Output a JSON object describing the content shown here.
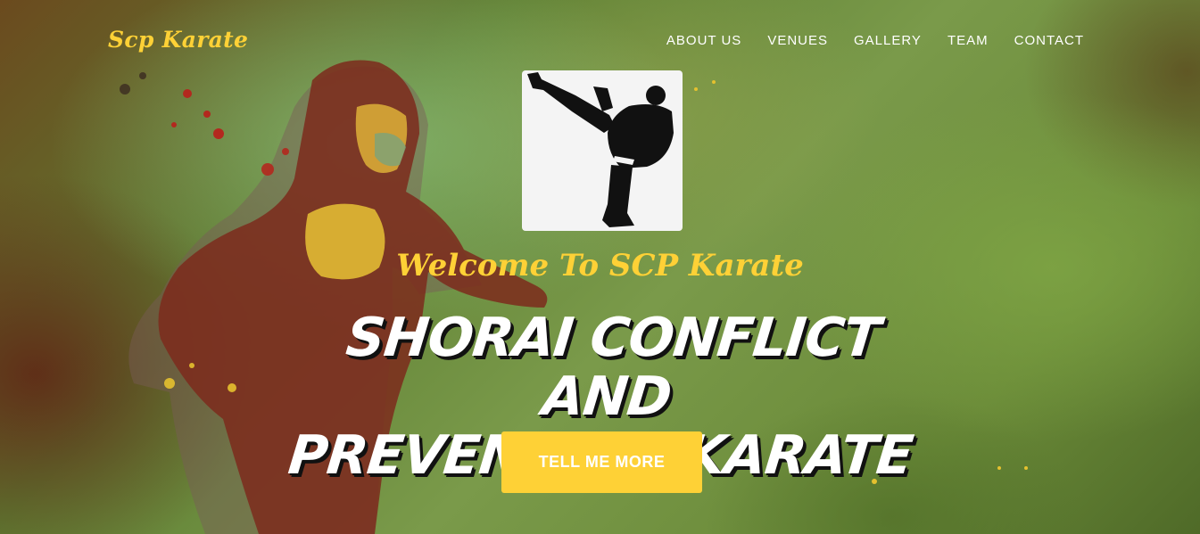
{
  "navbar": {
    "brand": "Scp Karate",
    "links": [
      "ABOUT US",
      "VENUES",
      "GALLERY",
      "TEAM",
      "CONTACT"
    ]
  },
  "hero": {
    "logo_alt": "karate-kick-silhouette",
    "lead_in": "Welcome To SCP Karate",
    "heading_line1": "SHORAI CONFLICT AND",
    "heading_line2": "PREVENTION KARATE",
    "cta_label": "TELL ME MORE"
  },
  "colors": {
    "accent": "#fed136",
    "nav_text": "#ffffff",
    "heading_text": "#ffffff"
  }
}
